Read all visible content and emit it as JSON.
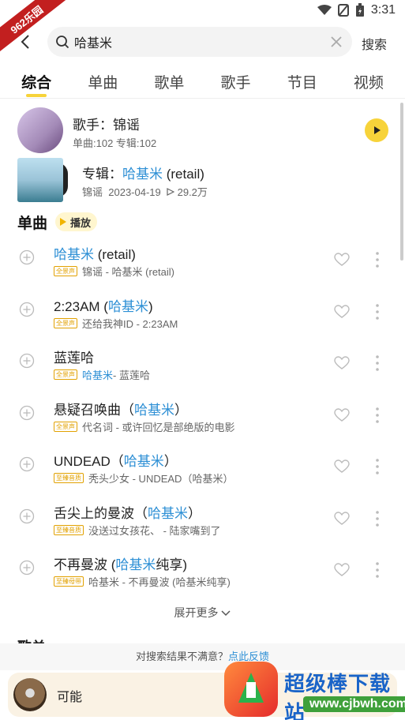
{
  "status": {
    "time": "3:31"
  },
  "ribbon": {
    "text": "962乐园"
  },
  "search": {
    "value": "哈基米",
    "placeholder": "",
    "submit_label": "搜索"
  },
  "tabs": [
    {
      "label": "综合",
      "active": true
    },
    {
      "label": "单曲"
    },
    {
      "label": "歌单"
    },
    {
      "label": "歌手"
    },
    {
      "label": "节目"
    },
    {
      "label": "视频"
    }
  ],
  "artist": {
    "title": "歌手：锦谣",
    "sub": "单曲:102  专辑:102"
  },
  "album": {
    "prefix": "专辑：",
    "highlight": "哈基米",
    "suffix": " (retail)",
    "artist": "锦谣",
    "date": "2023-04-19",
    "plays": "29.2万"
  },
  "songs_section": {
    "title": "单曲",
    "play_label": "播放"
  },
  "songs": [
    {
      "title_pre": "",
      "title_hl": "哈基米",
      "title_post": " (retail)",
      "badge": "全景声",
      "meta_pre": "锦谣 - 哈基米 (retail)",
      "meta_hl": "",
      "meta_post": ""
    },
    {
      "title_pre": "2:23AM (",
      "title_hl": "哈基米",
      "title_post": ")",
      "badge": "全景声",
      "meta_pre": "还给我神ID - 2:23AM",
      "meta_hl": "",
      "meta_post": ""
    },
    {
      "title_pre": "蓝莲哈",
      "title_hl": "",
      "title_post": "",
      "badge": "全景声",
      "meta_pre": "",
      "meta_hl": "哈基米",
      "meta_post": " - 蓝莲哈"
    },
    {
      "title_pre": "悬疑召唤曲（",
      "title_hl": "哈基米",
      "title_post": "）",
      "badge": "全景声",
      "meta_pre": "代名词 - 或许回忆是部绝版的电影",
      "meta_hl": "",
      "meta_post": ""
    },
    {
      "title_pre": "UNDEAD（",
      "title_hl": "哈基米",
      "title_post": "）",
      "badge": "至臻音质",
      "meta_pre": "秃头少女 - UNDEAD（哈基米）",
      "meta_hl": "",
      "meta_post": ""
    },
    {
      "title_pre": "舌尖上的曼波（",
      "title_hl": "哈基米",
      "title_post": "）",
      "badge": "至臻音质",
      "meta_pre": "没送过女孩花、 - 陆家嘴到了",
      "meta_hl": "",
      "meta_post": ""
    },
    {
      "title_pre": "不再曼波 (",
      "title_hl": "哈基米",
      "title_post": "纯享)",
      "badge": "至臻母带",
      "meta_pre": "哈基米 - 不再曼波 (哈基米纯享)",
      "meta_hl": "",
      "meta_post": ""
    }
  ],
  "expand_more": "展开更多",
  "next_section_title": "歌单",
  "feedback": {
    "text": "对搜索结果不满意？",
    "link": "点此反馈"
  },
  "player": {
    "title": "可能"
  },
  "watermark": {
    "text": "超级棒下载站",
    "url": "www.cjbwh.com"
  },
  "colors": {
    "accent": "#f7d33a",
    "highlight": "#2d8fd5"
  }
}
